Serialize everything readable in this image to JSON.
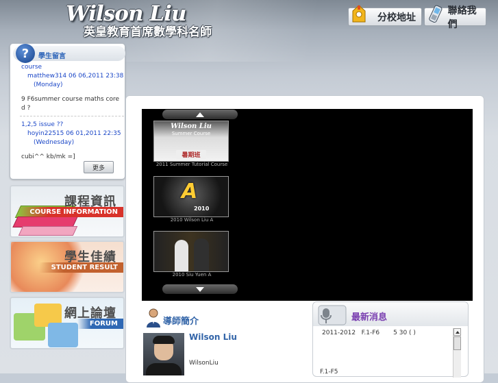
{
  "header": {
    "logo_en": "Wilson Liu",
    "logo_zh": "英皇教育首席數學科名師",
    "branch_button": "分校地址",
    "contact_button": "聯絡我們"
  },
  "messages": {
    "title": "學生留言",
    "posts": [
      {
        "subject": "course",
        "meta": "matthew314   06 06,2011 23:38 (Monday)",
        "body": "9     F6summer course maths core d ?"
      },
      {
        "subject": "1,2,5 issue     ??",
        "meta": "hoyin22515   06 01,2011 22:35 (Wednesday)",
        "body": "cubi^^     kb/mk =]"
      }
    ],
    "more_button": "更多"
  },
  "banners": [
    {
      "zh": "課程資訊",
      "en": "COURSE INFORMATION"
    },
    {
      "zh": "學生佳績",
      "en": "STUDENT RESULT"
    },
    {
      "zh": "網上論壇",
      "en": "FORUM"
    }
  ],
  "slider": {
    "items": [
      {
        "caption": "2011 Summer Tutorial Course",
        "thumb_title": "Wilson Liu",
        "thumb_sub": "Summer Course",
        "thumb_tag": "暑期班"
      },
      {
        "caption": "2010 Wilson Liu  A",
        "thumb_title": "A",
        "thumb_sub": "2010"
      },
      {
        "caption": "2010 Siu Yuen  A"
      }
    ]
  },
  "teacher": {
    "section_title": "導師簡介",
    "name": "Wilson Liu",
    "handle": "WilsonLiu"
  },
  "news": {
    "section_title": "最新消息",
    "items": [
      "2011-2012   F.1-F6       5 30 ( )",
      "F.1-F5"
    ]
  },
  "colors": {
    "accent": "#3264a8",
    "news": "#7a3fb0",
    "course_en": "#d8322a",
    "result_en": "#c2612e",
    "forum_en": "#2f68b4"
  }
}
